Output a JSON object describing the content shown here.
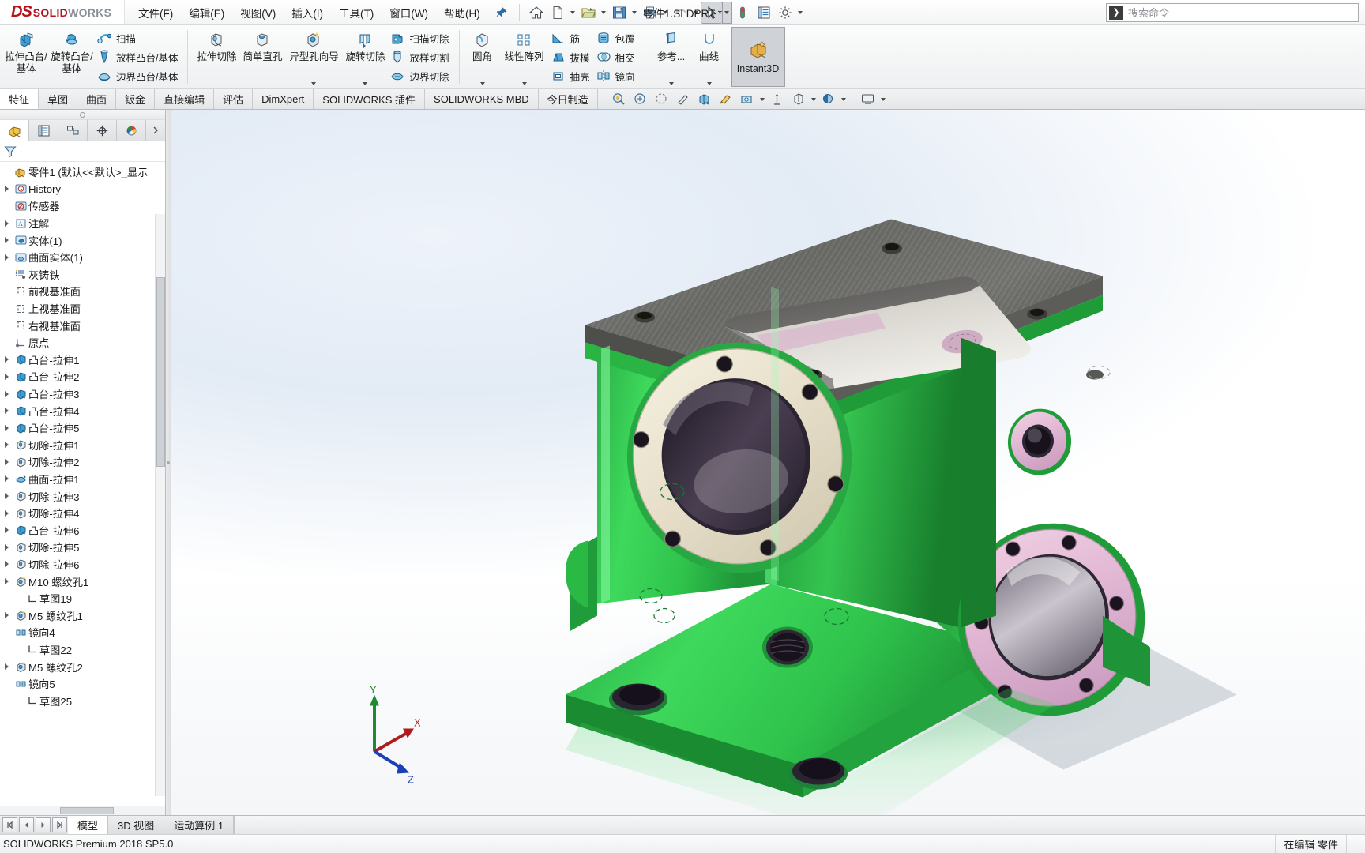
{
  "app": {
    "brand_ds": "DS",
    "brand_main": "SOLID",
    "brand_light": "WORKS",
    "document_title": "零件1.SLDPRT *",
    "status_version": "SOLIDWORKS Premium 2018 SP5.0",
    "status_edit_mode": "在编辑 零件"
  },
  "menu": {
    "items": [
      {
        "label": "文件(F)",
        "name": "menu-file"
      },
      {
        "label": "编辑(E)",
        "name": "menu-edit"
      },
      {
        "label": "视图(V)",
        "name": "menu-view"
      },
      {
        "label": "插入(I)",
        "name": "menu-insert"
      },
      {
        "label": "工具(T)",
        "name": "menu-tools"
      },
      {
        "label": "窗口(W)",
        "name": "menu-window"
      },
      {
        "label": "帮助(H)",
        "name": "menu-help"
      }
    ]
  },
  "quick_toolbar": {
    "icons": [
      "home-icon",
      "new-document-icon",
      "open-folder-icon",
      "save-icon",
      "print-icon",
      "undo-icon",
      "select-arrow-icon",
      "rebuild-icon",
      "options-list-icon",
      "settings-gear-icon"
    ]
  },
  "search": {
    "placeholder": "搜索命令",
    "icon": "search-command-icon"
  },
  "ribbon": {
    "groups": [
      {
        "name": "features-boss",
        "big": [
          {
            "label": "拉伸凸台/基体",
            "icon": "extrude-boss-icon",
            "dropdown": false
          },
          {
            "label": "旋转凸台/基体",
            "icon": "revolve-boss-icon",
            "dropdown": false
          }
        ],
        "small": [
          {
            "label": "扫描",
            "icon": "sweep-icon"
          },
          {
            "label": "放样凸台/基体",
            "icon": "loft-boss-icon"
          },
          {
            "label": "边界凸台/基体",
            "icon": "boundary-boss-icon"
          }
        ]
      },
      {
        "name": "features-cut",
        "big": [
          {
            "label": "拉伸切除",
            "icon": "extrude-cut-icon",
            "dropdown": false
          },
          {
            "label": "简单直孔",
            "icon": "simple-hole-icon",
            "dropdown": false
          },
          {
            "label": "异型孔向导",
            "icon": "hole-wizard-icon",
            "dropdown": true
          },
          {
            "label": "旋转切除",
            "icon": "revolve-cut-icon",
            "dropdown": true
          }
        ],
        "small": [
          {
            "label": "扫描切除",
            "icon": "sweep-cut-icon"
          },
          {
            "label": "放样切割",
            "icon": "loft-cut-icon"
          },
          {
            "label": "边界切除",
            "icon": "boundary-cut-icon"
          }
        ]
      },
      {
        "name": "features-modify",
        "big": [
          {
            "label": "圆角",
            "icon": "fillet-icon",
            "dropdown": true
          },
          {
            "label": "线性阵列",
            "icon": "linear-pattern-icon",
            "dropdown": true
          }
        ],
        "small": [
          {
            "label": "筋",
            "icon": "rib-icon"
          },
          {
            "label": "拔模",
            "icon": "draft-icon"
          },
          {
            "label": "抽壳",
            "icon": "shell-icon"
          }
        ],
        "small2": [
          {
            "label": "包覆",
            "icon": "wrap-icon"
          },
          {
            "label": "相交",
            "icon": "intersect-icon"
          },
          {
            "label": "镜向",
            "icon": "mirror-icon"
          }
        ]
      },
      {
        "name": "features-reference",
        "big": [
          {
            "label": "参考...",
            "icon": "reference-geometry-icon",
            "dropdown": true
          },
          {
            "label": "曲线",
            "icon": "curves-icon",
            "dropdown": true
          }
        ]
      }
    ],
    "instant3d": {
      "label": "Instant3D",
      "icon": "instant3d-icon"
    }
  },
  "command_tabs": {
    "items": [
      {
        "label": "特征",
        "name": "tab-features",
        "active": true
      },
      {
        "label": "草图",
        "name": "tab-sketch",
        "active": false
      },
      {
        "label": "曲面",
        "name": "tab-surfaces",
        "active": false
      },
      {
        "label": "钣金",
        "name": "tab-sheet-metal",
        "active": false
      },
      {
        "label": "直接编辑",
        "name": "tab-direct-edit",
        "active": false
      },
      {
        "label": "评估",
        "name": "tab-evaluate",
        "active": false
      },
      {
        "label": "DimXpert",
        "name": "tab-dimxpert",
        "active": false
      },
      {
        "label": "SOLIDWORKS 插件",
        "name": "tab-addins",
        "active": false
      },
      {
        "label": "SOLIDWORKS MBD",
        "name": "tab-mbd",
        "active": false
      },
      {
        "label": "今日制造",
        "name": "tab-manufacturing-today",
        "active": false
      }
    ],
    "view_icons": [
      "zoom-to-fit-icon",
      "zoom-to-area-icon",
      "previous-view-icon",
      "section-view-icon",
      "view-orientation-icon",
      "display-style-icon",
      "hide-show-items-icon",
      "edit-appearance-icon",
      "apply-scene-icon",
      "view-settings-icon"
    ]
  },
  "tree_panel": {
    "tabs": [
      {
        "name": "feature-manager-tab",
        "icon": "feature-tree-icon",
        "active": true
      },
      {
        "name": "property-manager-tab",
        "icon": "property-list-icon",
        "active": false
      },
      {
        "name": "configuration-manager-tab",
        "icon": "configuration-icon",
        "active": false
      },
      {
        "name": "dimxpert-manager-tab",
        "icon": "dimxpert-crosshair-icon",
        "active": false
      },
      {
        "name": "display-manager-tab",
        "icon": "display-sphere-icon",
        "active": false
      }
    ],
    "filter_icon": "filter-funnel-icon",
    "root": {
      "label": "零件1  (默认<<默认>_显示",
      "icon": "part-icon"
    },
    "items": [
      {
        "label": "History",
        "icon": "history-folder-icon",
        "arrow": true,
        "indent": 0
      },
      {
        "label": "传感器",
        "icon": "sensors-folder-icon",
        "arrow": false,
        "indent": 0
      },
      {
        "label": "注解",
        "icon": "annotations-icon",
        "arrow": true,
        "indent": 0
      },
      {
        "label": "实体(1)",
        "icon": "solid-bodies-icon",
        "arrow": true,
        "indent": 0
      },
      {
        "label": "曲面实体(1)",
        "icon": "surface-bodies-icon",
        "arrow": true,
        "indent": 0
      },
      {
        "label": "灰铸铁",
        "icon": "material-icon",
        "arrow": false,
        "indent": 0
      },
      {
        "label": "前视基准面",
        "icon": "plane-icon",
        "arrow": false,
        "indent": 0
      },
      {
        "label": "上视基准面",
        "icon": "plane-icon",
        "arrow": false,
        "indent": 0
      },
      {
        "label": "右视基准面",
        "icon": "plane-icon",
        "arrow": false,
        "indent": 0
      },
      {
        "label": "原点",
        "icon": "origin-icon",
        "arrow": false,
        "indent": 0
      },
      {
        "label": "凸台-拉伸1",
        "icon": "boss-extrude-icon",
        "arrow": true,
        "indent": 0
      },
      {
        "label": "凸台-拉伸2",
        "icon": "boss-extrude-icon",
        "arrow": true,
        "indent": 0
      },
      {
        "label": "凸台-拉伸3",
        "icon": "boss-extrude-icon",
        "arrow": true,
        "indent": 0
      },
      {
        "label": "凸台-拉伸4",
        "icon": "boss-extrude-icon",
        "arrow": true,
        "indent": 0
      },
      {
        "label": "凸台-拉伸5",
        "icon": "boss-extrude-icon",
        "arrow": true,
        "indent": 0
      },
      {
        "label": "切除-拉伸1",
        "icon": "cut-extrude-icon",
        "arrow": true,
        "indent": 0
      },
      {
        "label": "切除-拉伸2",
        "icon": "cut-extrude-icon",
        "arrow": true,
        "indent": 0
      },
      {
        "label": "曲面-拉伸1",
        "icon": "surface-extrude-icon",
        "arrow": true,
        "indent": 0
      },
      {
        "label": "切除-拉伸3",
        "icon": "cut-extrude-icon",
        "arrow": true,
        "indent": 0
      },
      {
        "label": "切除-拉伸4",
        "icon": "cut-extrude-icon",
        "arrow": true,
        "indent": 0
      },
      {
        "label": "凸台-拉伸6",
        "icon": "boss-extrude-icon",
        "arrow": true,
        "indent": 0
      },
      {
        "label": "切除-拉伸5",
        "icon": "cut-extrude-icon",
        "arrow": true,
        "indent": 0
      },
      {
        "label": "切除-拉伸6",
        "icon": "cut-extrude-icon",
        "arrow": true,
        "indent": 0
      },
      {
        "label": "M10 螺纹孔1",
        "icon": "hole-wizard-feature-icon",
        "arrow": true,
        "indent": 0
      },
      {
        "label": "草图19",
        "icon": "sketch-icon",
        "arrow": false,
        "indent": 1
      },
      {
        "label": "M5 螺纹孔1",
        "icon": "hole-wizard-feature-icon",
        "arrow": true,
        "indent": 0
      },
      {
        "label": "镜向4",
        "icon": "mirror-feature-icon",
        "arrow": false,
        "indent": 0
      },
      {
        "label": "草图22",
        "icon": "sketch-icon",
        "arrow": false,
        "indent": 1
      },
      {
        "label": "M5 螺纹孔2",
        "icon": "hole-wizard-feature-icon",
        "arrow": true,
        "indent": 0
      },
      {
        "label": "镜向5",
        "icon": "mirror-feature-icon",
        "arrow": false,
        "indent": 0
      },
      {
        "label": "草图25",
        "icon": "sketch-icon",
        "arrow": false,
        "indent": 1
      }
    ]
  },
  "graphics": {
    "triad": {
      "x_label": "X",
      "y_label": "Y",
      "z_label": "Z"
    },
    "model_colors": {
      "body_green": "#2ec24a",
      "body_green_dark": "#1f9c38",
      "machined_gray": "#6f6f6c",
      "flange_cream": "#efe8d6",
      "flange_pink": "#e8bfd8",
      "bore_dark": "#3a3140",
      "background_top": "#e3ebf5",
      "background_bottom": "#ffffff"
    }
  },
  "bottom_tabs": {
    "nav_icons": [
      "first-icon",
      "prev-icon",
      "next-icon",
      "last-icon"
    ],
    "items": [
      {
        "label": "模型",
        "name": "bottom-tab-model",
        "active": true
      },
      {
        "label": "3D 视图",
        "name": "bottom-tab-3d-views",
        "active": false
      },
      {
        "label": "运动算例 1",
        "name": "bottom-tab-motion-study-1",
        "active": false
      }
    ]
  }
}
